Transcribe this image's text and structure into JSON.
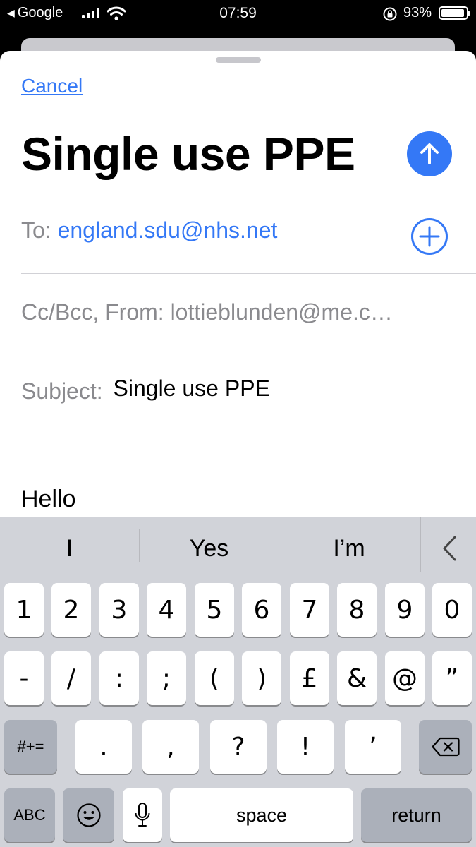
{
  "status_bar": {
    "back_app": "Google",
    "time": "07:59",
    "battery_pct": "93%",
    "battery_level": 0.93
  },
  "compose": {
    "cancel_label": "Cancel",
    "title": "Single use PPE",
    "to_label": "To:",
    "to_value": "england.sdu@nhs.net",
    "ccbcc_label": "Cc/Bcc, From:",
    "from_value": "lottieblunden@me.c…",
    "subject_label": "Subject:",
    "subject_value": "Single use PPE",
    "body": "Hello"
  },
  "keyboard": {
    "predictions": [
      "I",
      "Yes",
      "I’m"
    ],
    "row1": [
      "1",
      "2",
      "3",
      "4",
      "5",
      "6",
      "7",
      "8",
      "9",
      "0"
    ],
    "row2": [
      "-",
      "/",
      ":",
      ";",
      "(",
      ")",
      "£",
      "&",
      "@",
      "”"
    ],
    "row3_left": "#+=",
    "row3": [
      ".",
      ",",
      "?",
      "!",
      "’"
    ],
    "abc_label": "ABC",
    "space_label": "space",
    "return_label": "return"
  },
  "icons": {
    "send": "arrow-up-circle-icon",
    "add_recipient": "plus-circle-icon",
    "delete": "backspace-icon",
    "emoji": "emoji-icon",
    "dictation": "microphone-icon",
    "collapse": "chevron-left-icon"
  },
  "colors": {
    "accent": "#3478f6",
    "keyboard_bg": "#d1d3d9",
    "key_dark": "#abb0ba"
  }
}
